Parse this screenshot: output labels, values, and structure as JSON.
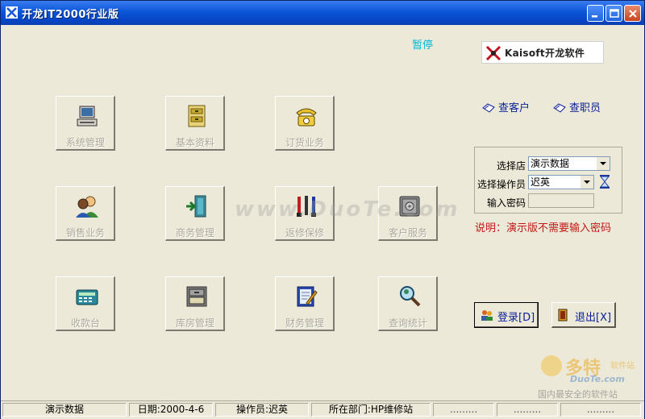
{
  "window": {
    "title": "开龙IT2000行业版",
    "pause_label": "暂停",
    "logo_text": "Kaisoft开龙软件"
  },
  "modules": [
    {
      "label": "系统管理",
      "icon": "computer-icon"
    },
    {
      "label": "基本资料",
      "icon": "filing-cabinet-icon"
    },
    {
      "label": "订货业务",
      "icon": "telephone-icon"
    },
    {
      "label": "销售业务",
      "icon": "people-icon"
    },
    {
      "label": "商务管理",
      "icon": "door-exit-icon"
    },
    {
      "label": "返修保修",
      "icon": "tools-icon"
    },
    {
      "label": "客户服务",
      "icon": "safe-icon"
    },
    {
      "label": "收款台",
      "icon": "calculator-icon"
    },
    {
      "label": "库房管理",
      "icon": "drawer-icon"
    },
    {
      "label": "财务管理",
      "icon": "ledger-pen-icon"
    },
    {
      "label": "查询统计",
      "icon": "magnifier-icon"
    }
  ],
  "links": {
    "query_customer": "查客户",
    "query_staff": "查职员"
  },
  "login": {
    "store_label": "选择店",
    "store_value": "演示数据",
    "operator_label": "选择操作员",
    "operator_value": "迟英",
    "password_label": "输入密码",
    "note": "说明：演示版不需要输入密码",
    "login_button": "登录[D]",
    "exit_button": "退出[X]"
  },
  "statusbar": {
    "store": "演示数据",
    "date": "日期:2000-4-6",
    "operator": "操作员:迟英",
    "department": "所在部门:HP维修站",
    "cell5": ".........",
    "cell6": ".........",
    "cell7": "........."
  },
  "watermarks": {
    "center": "www.DuoTe.com",
    "corner_title": "多特",
    "corner_sub": "软件站",
    "corner_url": "DuoTe.com",
    "corner_slogan": "国内最安全的软件站"
  },
  "colors": {
    "titlebar": "#0a56d8",
    "pause": "#00b8d8",
    "link": "#0a1f9a",
    "note": "#c01818",
    "disabled_label": "#aca899"
  }
}
